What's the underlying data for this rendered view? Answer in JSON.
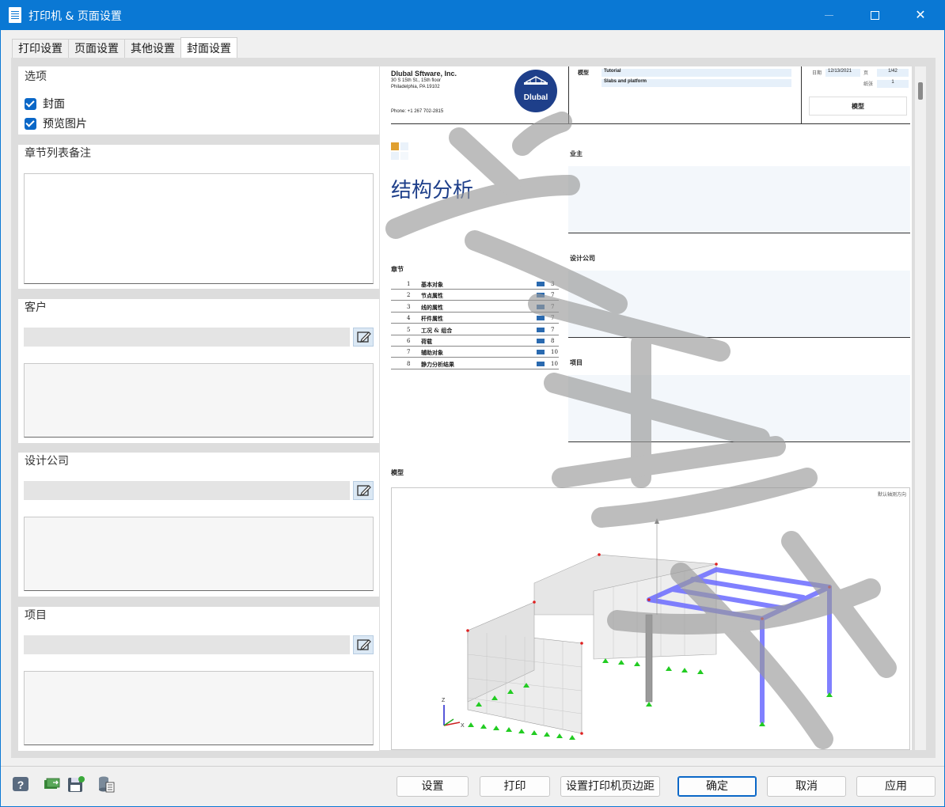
{
  "window": {
    "title": "打印机 & 页面设置"
  },
  "tabs": [
    {
      "label": "打印设置"
    },
    {
      "label": "页面设置"
    },
    {
      "label": "其他设置"
    },
    {
      "label": "封面设置"
    }
  ],
  "options": {
    "title": "选项",
    "cover_label": "封面",
    "preview_label": "预览图片"
  },
  "chapter_notes": {
    "title": "章节列表备注"
  },
  "client": {
    "title": "客户"
  },
  "design_company": {
    "title": "设计公司"
  },
  "project": {
    "title": "项目"
  },
  "preview": {
    "company_name": "Dlubal Sftware, Inc.",
    "company_addr1": "30 S 15th St., 15th floor",
    "company_addr2": "Philadelphia, PA 19102",
    "company_phone": "Phone: +1 267 702-2815",
    "logo_text": "Dlubal",
    "model_label": "模型",
    "model_value1": "Tutorial",
    "model_value2": "Slabs and platform",
    "date_label": "日期",
    "date_value": "12/13/2021",
    "page_label": "页",
    "page_value": "1/42",
    "sheet_label": "纸张",
    "sheet_value": "1",
    "model_box": "模型",
    "owner_label": "业主",
    "main_title": "结构分析",
    "design_label": "设计公司",
    "project_label": "项目",
    "chapters_label": "章节",
    "model_section_label": "模型",
    "view_label": "默认轴测方向",
    "chapters": [
      {
        "num": "1",
        "name": "基本对象",
        "page": "3"
      },
      {
        "num": "2",
        "name": "节点属性",
        "page": "7"
      },
      {
        "num": "3",
        "name": "线的属性",
        "page": "7"
      },
      {
        "num": "4",
        "name": "杆件属性",
        "page": "7"
      },
      {
        "num": "5",
        "name": "工况 & 组合",
        "page": "7"
      },
      {
        "num": "6",
        "name": "荷载",
        "page": "8"
      },
      {
        "num": "7",
        "name": "辅助对象",
        "page": "10"
      },
      {
        "num": "8",
        "name": "静力分析结果",
        "page": "10"
      }
    ]
  },
  "buttons": {
    "settings": "设置",
    "print": "打印",
    "margins": "设置打印机页边距",
    "ok": "确定",
    "cancel": "取消",
    "apply": "应用"
  },
  "colors": {
    "accent": "#0a78d4",
    "member_blue": "#6b6bff",
    "support_green": "#22cc22"
  }
}
